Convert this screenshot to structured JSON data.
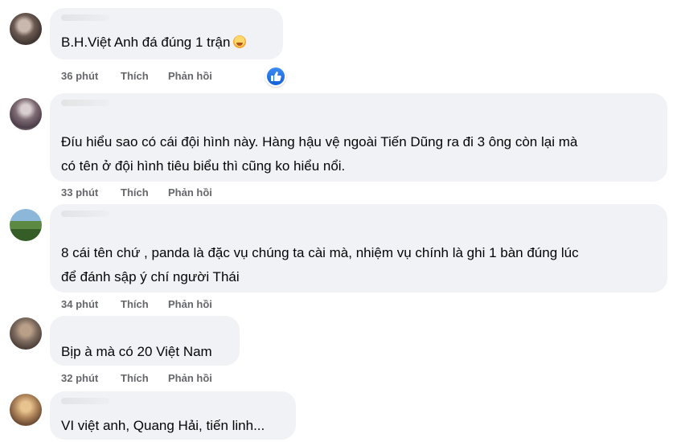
{
  "comments": [
    {
      "text_lines": [
        "B.H.Việt Anh đá đúng 1 trận"
      ],
      "time": "36 phút",
      "like": "Thích",
      "reply": "Phản hồi"
    },
    {
      "text_lines": [
        "Đíu hiểu sao có cái đội hình này. Hàng hậu vệ ngoài Tiến Dũng ra đi 3 ông còn lại mà",
        "có tên ở đội hình tiêu biểu thì cũng ko hiểu nổi."
      ],
      "time": "33 phút",
      "like": "Thích",
      "reply": "Phản hồi"
    },
    {
      "text_lines": [
        "8 cái tên chứ , panda là đặc vụ chúng ta cài mà, nhiệm vụ chính là ghi 1 bàn đúng lúc",
        "để đánh sập ý chí người Thái"
      ],
      "time": "34 phút",
      "like": "Thích",
      "reply": "Phản hồi"
    },
    {
      "text_lines": [
        "Bịp à mà có 20 Việt Nam"
      ],
      "time": "32 phút",
      "like": "Thích",
      "reply": "Phản hồi"
    },
    {
      "text_lines": [
        "VI việt anh, Quang Hải, tiến linh..."
      ]
    }
  ],
  "icons": {
    "reaction": "laughing-emoji-icon",
    "like_badge": "like-thumb-icon"
  },
  "colors": {
    "bubble": "#f0f2f5",
    "meta": "#65676b",
    "like_blue": "#1877f2"
  }
}
